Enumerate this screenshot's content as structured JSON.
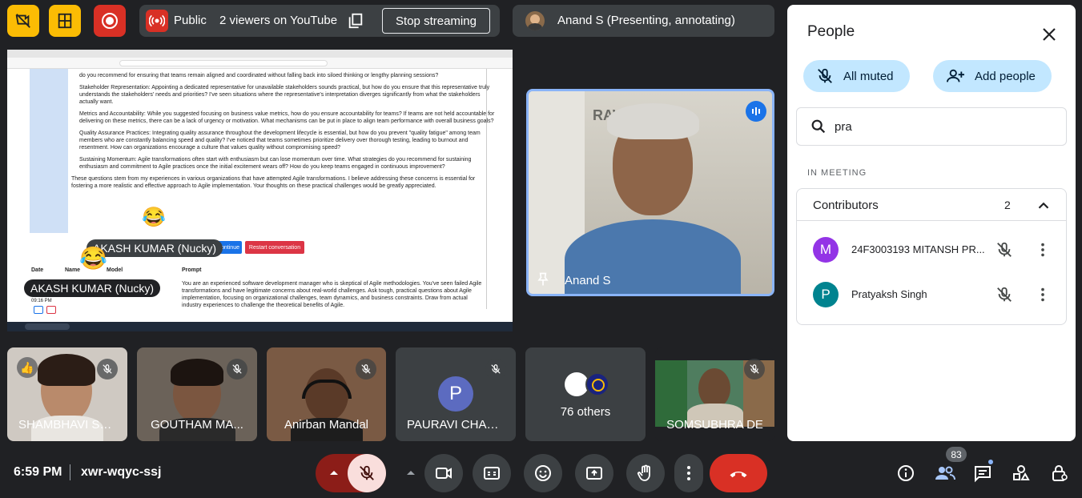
{
  "topbar": {
    "visibility": "Public",
    "viewers": "2 viewers on YouTube",
    "stop_label": "Stop streaming",
    "presenter": "Anand S (Presenting, annotating)"
  },
  "presentation": {
    "doc_lines": [
      "do you recommend for ensuring that teams remain aligned and coordinated without falling back into siloed thinking or lengthy planning sessions?",
      "Stakeholder Representation: Appointing a dedicated representative for unavailable stakeholders sounds practical, but how do you ensure that this representative truly understands the stakeholders' needs and priorities? I've seen situations where the representative's interpretation diverges significantly from what the stakeholders actually want.",
      "Metrics and Accountability: While you suggested focusing on business value metrics, how do you ensure accountability for teams? If teams are not held accountable for delivering on these metrics, there can be a lack of urgency or motivation. What mechanisms can be put in place to align team performance with overall business goals?",
      "Quality Assurance Practices: Integrating quality assurance throughout the development lifecycle is essential, but how do you prevent \"quality fatigue\" among team members who are constantly balancing speed and quality? I've noticed that teams sometimes prioritize delivery over thorough testing, leading to burnout and resentment. How can organizations encourage a culture that values quality without compromising speed?",
      "Sustaining Momentum: Agile transformations often start with enthusiasm but can lose momentum over time. What strategies do you recommend for sustaining enthusiasm and commitment to Agile practices once the initial excitement wears off? How do you keep teams engaged in continuous improvement?",
      "These questions stem from my experiences in various organizations that have attempted Agile transformations. I believe addressing these concerns is essential for fostering a more realistic and effective approach to Agile implementation. Your thoughts on these practical challenges would be greatly appreciated."
    ],
    "buttons": {
      "continue": "Continue",
      "restart": "Restart conversation"
    },
    "table_headers": [
      "Date",
      "Name",
      "Model",
      "Prompt"
    ],
    "prompt_text": "You are an experienced software development manager who is skeptical of Agile methodologies. You've seen failed Agile transformations and have legitimate concerns about real-world challenges. Ask tough, practical questions about Agile implementation, focusing on organizational challenges, team dynamics, and business constraints. Draw from actual industry experiences to challenge the theoretical benefits of Agile.",
    "time": "09:16 PM",
    "annotation_1": "AKASH KUMAR (Nucky)",
    "annotation_2": "AKASH KUMAR (Nucky)",
    "reaction_emoji": "😂"
  },
  "main_speaker": {
    "name": "Anand S"
  },
  "participants": [
    {
      "name": "SHAMBHAVI SH...",
      "reaction": "👍"
    },
    {
      "name": "GOUTHAM MA..."
    },
    {
      "name": "Anirban Mandal"
    },
    {
      "name": "PAURAVI CHAN...",
      "initial": "P"
    },
    {
      "name": "76 others"
    },
    {
      "name": "SOMSUBHRA DE"
    }
  ],
  "people_panel": {
    "title": "People",
    "all_muted": "All muted",
    "add_people": "Add people",
    "search_value": "pra",
    "section": "IN MEETING",
    "group": "Contributors",
    "group_count": "2",
    "members": [
      {
        "initial": "M",
        "name": "24F3003193 MITANSH PR...",
        "color": "#9334e6"
      },
      {
        "initial": "P",
        "name": "Pratyaksh Singh",
        "color": "#00838f"
      }
    ]
  },
  "bottom": {
    "time": "6:59 PM",
    "meeting_code": "xwr-wqyc-ssj",
    "people_count": "83"
  }
}
